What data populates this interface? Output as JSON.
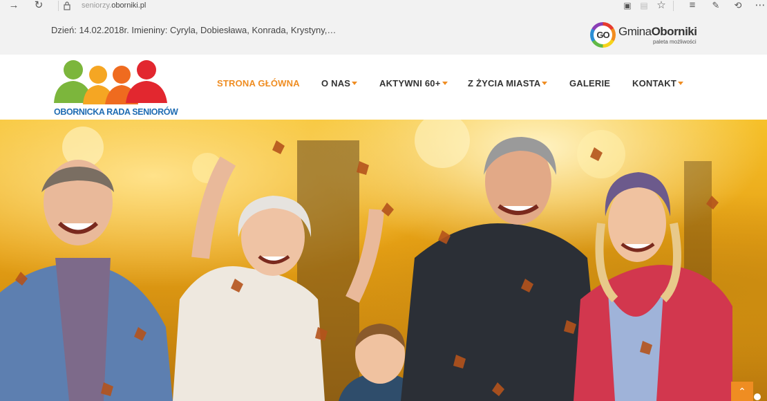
{
  "browser": {
    "url_prefix": "seniorzy.",
    "url_domain": "oborniki.pl"
  },
  "topbar": {
    "info": "Dzień: 14.02.2018r. Imieniny: Cyryla, Dobiesława, Konrada, Krystyny,…"
  },
  "partner_logo": {
    "badge": "GO",
    "name_part1": "Gmina",
    "name_part2": "Oborniki",
    "tagline": "paleta możliwości"
  },
  "site_logo": {
    "name": "OBORNICKA RADA SENIORÓW"
  },
  "nav": {
    "items": [
      {
        "label": "STRONA GŁÓWNA",
        "active": true,
        "has_dropdown": false
      },
      {
        "label": "O NAS",
        "active": false,
        "has_dropdown": true
      },
      {
        "label": "AKTYWNI 60+",
        "active": false,
        "has_dropdown": true
      },
      {
        "label": "Z ŻYCIA MIASTA",
        "active": false,
        "has_dropdown": true
      },
      {
        "label": "GALERIE",
        "active": false,
        "has_dropdown": false
      },
      {
        "label": "KONTAKT",
        "active": false,
        "has_dropdown": true
      }
    ]
  },
  "hero": {
    "image_subject": "family of four generations laughing under falling autumn leaves"
  },
  "colors": {
    "accent": "#ef8d22",
    "nav_text": "#333333",
    "logo_blue": "#1f6cb3",
    "topbar_bg": "#f2f2f2"
  }
}
